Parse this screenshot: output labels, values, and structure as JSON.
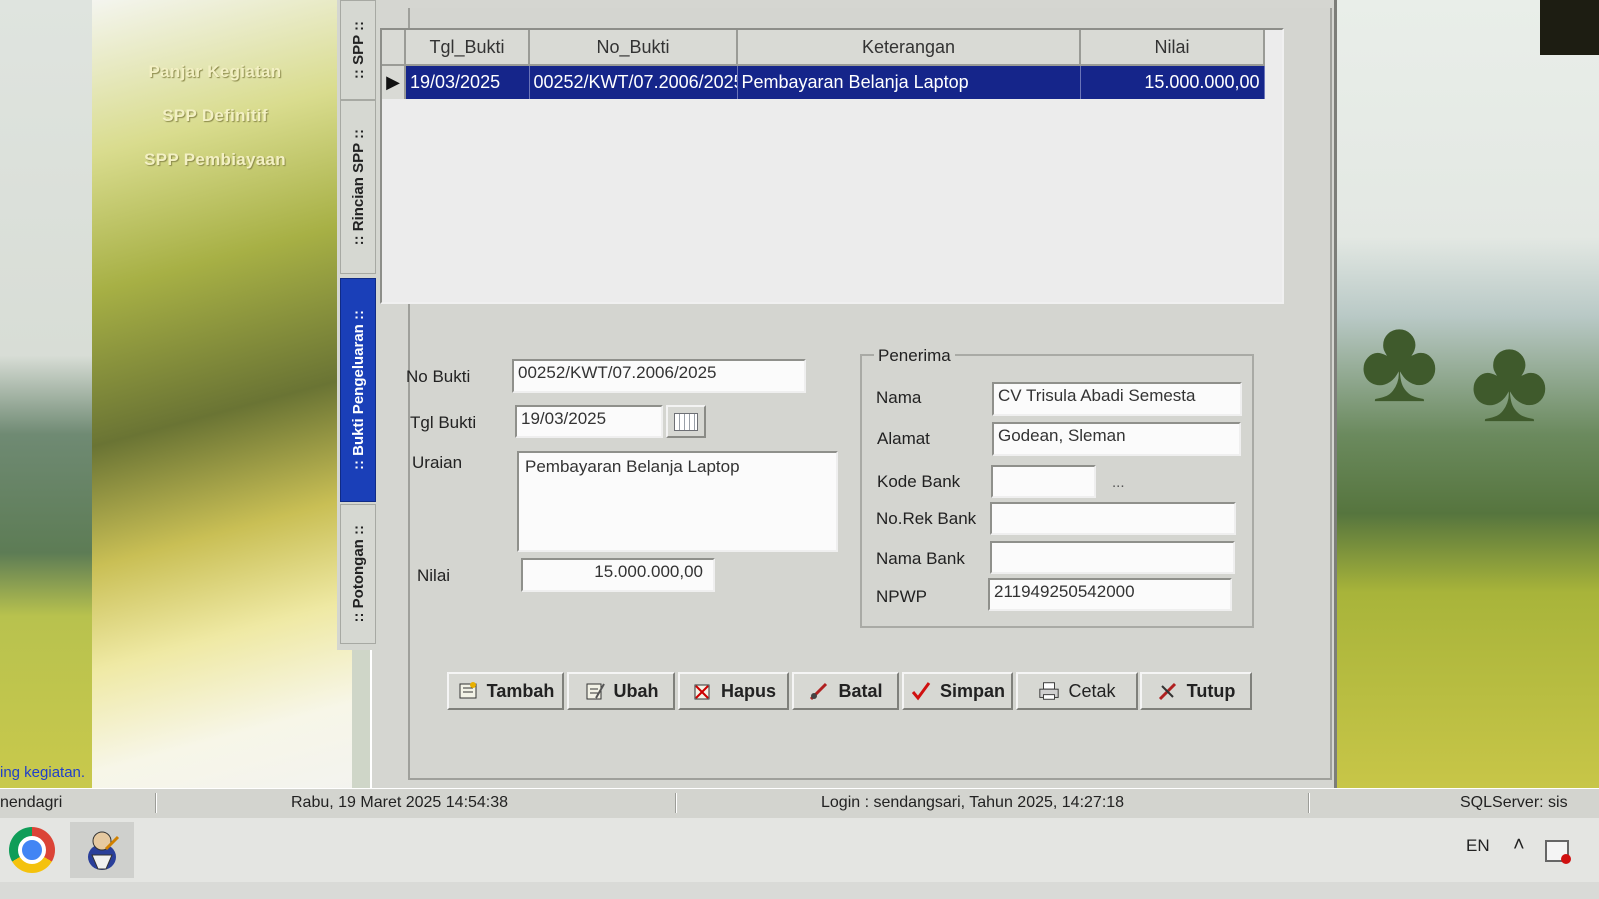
{
  "sidebar": {
    "links": [
      "Panjar Kegiatan",
      "SPP Definitif",
      "SPP Pembiayaan"
    ],
    "status_text": "ing kegiatan."
  },
  "tabs": [
    {
      "label": ":: SPP ::",
      "active": false
    },
    {
      "label": ":: Rincian SPP ::",
      "active": false
    },
    {
      "label": ":: Bukti Pengeluaran ::",
      "active": true
    },
    {
      "label": ":: Potongan ::",
      "active": false
    }
  ],
  "grid": {
    "columns": [
      "Tgl_Bukti",
      "No_Bukti",
      "Keterangan",
      "Nilai"
    ],
    "rows": [
      {
        "tgl_bukti": "19/03/2025",
        "no_bukti": "00252/KWT/07.2006/2025",
        "keterangan": "Pembayaran Belanja Laptop",
        "nilai": "15.000.000,00"
      }
    ],
    "row_indicator": "▶"
  },
  "form": {
    "no_bukti": {
      "label": "No Bukti",
      "value": "00252/KWT/07.2006/2025"
    },
    "tgl_bukti": {
      "label": "Tgl Bukti",
      "value": "19/03/2025"
    },
    "uraian": {
      "label": "Uraian",
      "value": "Pembayaran Belanja Laptop"
    },
    "nilai": {
      "label": "Nilai",
      "value": "15.000.000,00"
    }
  },
  "penerima": {
    "title": "Penerima",
    "nama": {
      "label": "Nama",
      "value": "CV Trisula Abadi Semesta"
    },
    "alamat": {
      "label": "Alamat",
      "value": "Godean, Sleman"
    },
    "kode_bank": {
      "label": "Kode Bank",
      "value": ""
    },
    "lookup": "...",
    "no_rek_bank": {
      "label": "No.Rek Bank",
      "value": ""
    },
    "nama_bank": {
      "label": "Nama Bank",
      "value": ""
    },
    "npwp": {
      "label": "NPWP",
      "value": "211949250542000"
    }
  },
  "buttons": {
    "tambah": "Tambah",
    "ubah": "Ubah",
    "hapus": "Hapus",
    "batal": "Batal",
    "simpan": "Simpan",
    "cetak": "Cetak",
    "tutup": "Tutup"
  },
  "statusbar": {
    "app": "nendagri",
    "datetime": "Rabu, 19 Maret 2025  14:54:38",
    "login": "Login : sendangsari,  Tahun 2025, 14:27:18",
    "server": "SQLServer: sis"
  },
  "taskbar": {
    "language": "EN",
    "tray_chevron": "˄"
  },
  "colors": {
    "selected_row": "#15258a",
    "active_tab": "#1a3fb8",
    "window_bg": "#d4d5d0"
  }
}
